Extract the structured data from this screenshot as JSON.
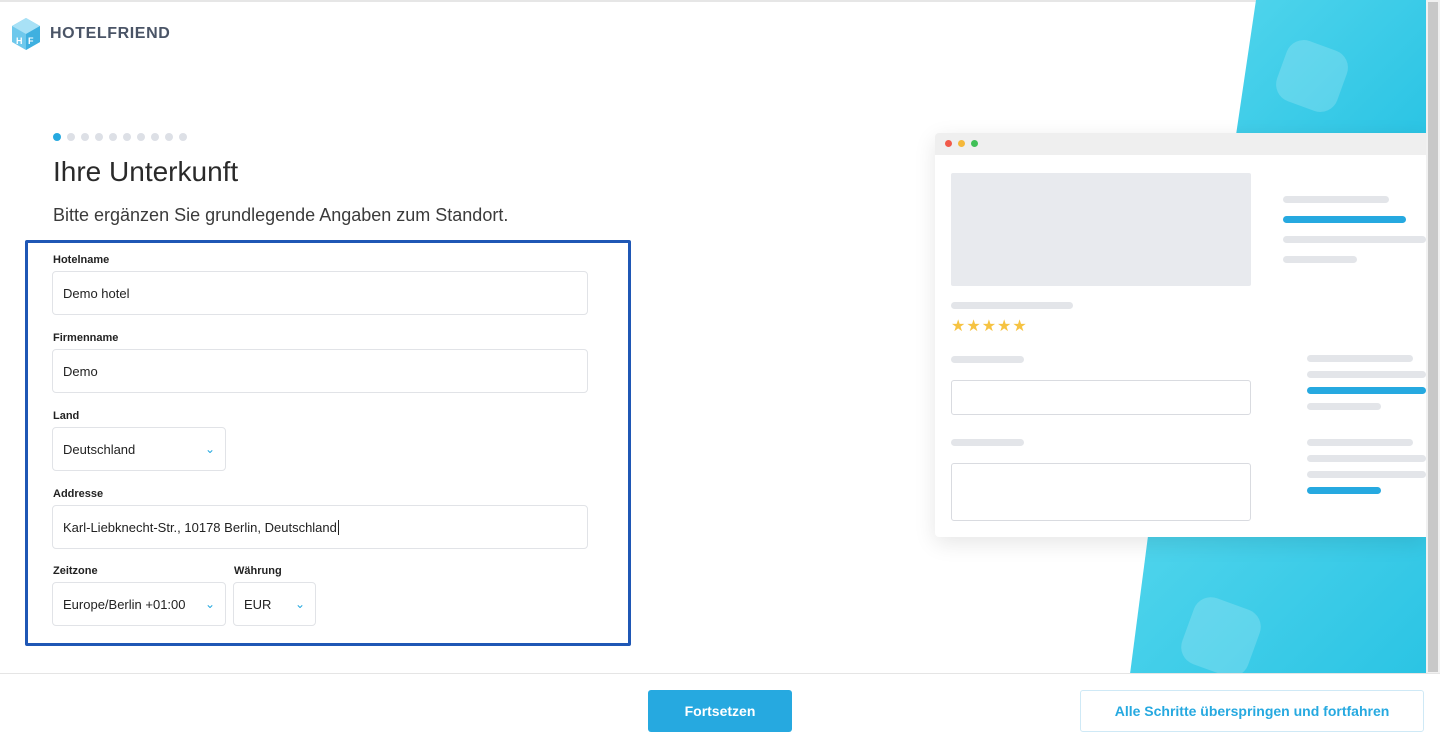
{
  "brand": {
    "name": "HOTELFRIEND",
    "logo_icon": "hf-cube-logo-icon"
  },
  "steps": {
    "total": 10,
    "current": 1
  },
  "page": {
    "title": "Ihre Unterkunft",
    "subtitle": "Bitte ergänzen Sie grundlegende Angaben zum Standort."
  },
  "form": {
    "hotel_name": {
      "label": "Hotelname",
      "value": "Demo hotel"
    },
    "company_name": {
      "label": "Firmenname",
      "value": "Demo"
    },
    "country": {
      "label": "Land",
      "value": "Deutschland"
    },
    "address": {
      "label": "Addresse",
      "value": "Karl-Liebknecht-Str., 10178 Berlin, Deutschland"
    },
    "timezone": {
      "label": "Zeitzone",
      "value": "Europe/Berlin +01:00"
    },
    "currency": {
      "label": "Währung",
      "value": "EUR"
    }
  },
  "preview": {
    "stars": "★★★★★",
    "rating": 5
  },
  "footer": {
    "continue_label": "Fortsetzen",
    "skip_label": "Alle Schritte überspringen und fortfahren"
  },
  "colors": {
    "accent": "#26a9e0",
    "highlight_border": "#1f57b5",
    "deco_cyan": "#3ccbe8",
    "star": "#f6c342"
  }
}
